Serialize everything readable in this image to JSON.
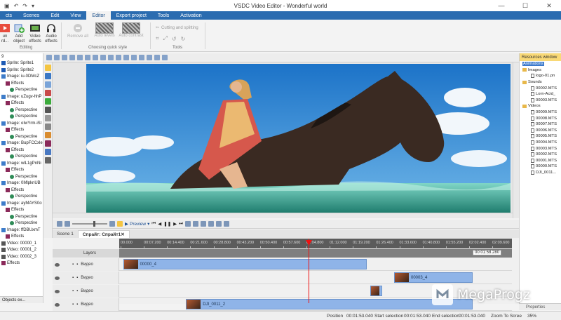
{
  "window": {
    "title": "VSDC Video Editor - Wonderful world",
    "controls": [
      "—",
      "☐",
      "✕"
    ]
  },
  "ribbon_tabs": [
    "cts",
    "Scenes",
    "Edit",
    "View",
    "Editor",
    "Export project",
    "Tools",
    "Activation"
  ],
  "ribbon_active_tab": "Editor",
  "ribbon": {
    "run_label": "un\nrd...",
    "add_object_label": "Add\nobject",
    "video_effects_label": "Video\neffects",
    "audio_effects_label": "Audio\neffects",
    "editing_group": "Editing",
    "remove_all_label": "Remove all",
    "auto_levels_label": "Auto levels",
    "auto_contrast_label": "Auto contrast",
    "quick_style_group": "Choosing quick style",
    "cutting_label": "Cutting and splitting",
    "tools_group": "Tools"
  },
  "object_tree": [
    {
      "label": "9",
      "icon": "none",
      "indent": 0
    },
    {
      "label": "Sprite: Sprite1",
      "icon": "blue",
      "indent": 0
    },
    {
      "label": "Sprite: Sprite2",
      "icon": "blue",
      "indent": 0
    },
    {
      "label": "Image: iu-0DMcZ",
      "icon": "img",
      "indent": 0
    },
    {
      "label": "Effects",
      "icon": "fx",
      "indent": 1
    },
    {
      "label": "Perspective",
      "icon": "persp",
      "indent": 2
    },
    {
      "label": "Image: uZugv-hhP",
      "icon": "img",
      "indent": 0
    },
    {
      "label": "Effects",
      "icon": "fx",
      "indent": 1
    },
    {
      "label": "Perspective",
      "icon": "persp",
      "indent": 2
    },
    {
      "label": "Perspective",
      "icon": "persp",
      "indent": 2
    },
    {
      "label": "Image: oIwYrm-iSI",
      "icon": "img",
      "indent": 0
    },
    {
      "label": "Effects",
      "icon": "fx",
      "indent": 1
    },
    {
      "label": "Perspective",
      "icon": "persp",
      "indent": 2
    },
    {
      "label": "Image: BupFCCxle",
      "icon": "img",
      "indent": 0
    },
    {
      "label": "Effects",
      "icon": "fx",
      "indent": 1
    },
    {
      "label": "Perspective",
      "icon": "persp",
      "indent": 2
    },
    {
      "label": "Image: wlL1gPnNi",
      "icon": "img",
      "indent": 0
    },
    {
      "label": "Effects",
      "icon": "fx",
      "indent": 1
    },
    {
      "label": "Perspective",
      "icon": "persp",
      "indent": 2
    },
    {
      "label": "Image: 0MlpknUB",
      "icon": "img",
      "indent": 0
    },
    {
      "label": "Effects",
      "icon": "fx",
      "indent": 1
    },
    {
      "label": "Perspective",
      "icon": "persp",
      "indent": 2
    },
    {
      "label": "Image: ayMAYS0o",
      "icon": "img",
      "indent": 0
    },
    {
      "label": "Effects",
      "icon": "fx",
      "indent": 1
    },
    {
      "label": "Perspective",
      "icon": "persp",
      "indent": 2
    },
    {
      "label": "Perspective",
      "icon": "persp",
      "indent": 2
    },
    {
      "label": "Image: ffDBUxmT",
      "icon": "img",
      "indent": 0
    },
    {
      "label": "Effects",
      "icon": "fx",
      "indent": 1
    },
    {
      "label": "Video: 00000_1",
      "icon": "vid",
      "indent": 0
    },
    {
      "label": "Video: 00001_2",
      "icon": "vid",
      "indent": 0
    },
    {
      "label": "Video: 00002_3",
      "icon": "vid",
      "indent": 0
    },
    {
      "label": "Effects",
      "icon": "fx",
      "indent": 0
    }
  ],
  "left_tabs": [
    "Objects ex..."
  ],
  "resources": {
    "header": "Resources window",
    "items": [
      {
        "label": "Animations",
        "type": "sel",
        "indent": 0
      },
      {
        "label": "Images",
        "type": "folder",
        "indent": 0
      },
      {
        "label": "logo-01.pn",
        "type": "file",
        "indent": 1
      },
      {
        "label": "Sounds",
        "type": "folder",
        "indent": 0
      },
      {
        "label": "00002.MTS",
        "type": "file",
        "indent": 1
      },
      {
        "label": "Lorn-Acid_",
        "type": "file",
        "indent": 1
      },
      {
        "label": "00003.MTS",
        "type": "file",
        "indent": 1
      },
      {
        "label": "Videos",
        "type": "folder",
        "indent": 0
      },
      {
        "label": "00009.MTS",
        "type": "file",
        "indent": 1
      },
      {
        "label": "00008.MTS",
        "type": "file",
        "indent": 1
      },
      {
        "label": "00007.MTS",
        "type": "file",
        "indent": 1
      },
      {
        "label": "00006.MTS",
        "type": "file",
        "indent": 1
      },
      {
        "label": "00005.MTS",
        "type": "file",
        "indent": 1
      },
      {
        "label": "00004.MTS",
        "type": "file",
        "indent": 1
      },
      {
        "label": "00003.MTS",
        "type": "file",
        "indent": 1
      },
      {
        "label": "00002.MTS",
        "type": "file",
        "indent": 1
      },
      {
        "label": "00001.MTS",
        "type": "file",
        "indent": 1
      },
      {
        "label": "00000.MTS",
        "type": "file",
        "indent": 1
      },
      {
        "label": "DJI_0011...",
        "type": "file",
        "indent": 1
      }
    ],
    "properties_label": "Properties"
  },
  "playback": {
    "preview_label": "Preview"
  },
  "scene_tabs": [
    {
      "label": "Scene 1",
      "active": false
    },
    {
      "label": "Спрайт: Спрайт1",
      "active": true
    }
  ],
  "timeline": {
    "layers_label": "Layers",
    "ruler_ticks": [
      "00.000",
      "00:07.200",
      "00:14.400",
      "00:21.600",
      "00:28.800",
      "00:43.200",
      "00:50.400",
      "00:57.600",
      "01:04.800",
      "01:12.000",
      "01:19.200",
      "01:26.400",
      "01:33.600",
      "01:40.800",
      "01:55.200",
      "02:02.400",
      "02:09.600"
    ],
    "current_time": "00:01:58.280",
    "tracks": [
      {
        "label": "Видео",
        "clips": [
          {
            "name": "00000_4",
            "start": 0.01,
            "end": 0.63
          }
        ]
      },
      {
        "label": "Видео",
        "clips": [
          {
            "name": "00003_4",
            "start": 0.7,
            "end": 0.9
          }
        ]
      },
      {
        "label": "Видео",
        "clips": [
          {
            "name": "",
            "start": 0.64,
            "end": 0.67
          }
        ]
      },
      {
        "label": "Видео",
        "clips": [
          {
            "name": "DJI_0011_2",
            "start": 0.17,
            "end": 0.9
          }
        ]
      }
    ]
  },
  "statusbar": {
    "position_label": "Position",
    "position_value": "00:01:53.040",
    "start_sel_label": "Start selection",
    "start_sel_value": "00:01:53.040",
    "end_sel_label": "End selection",
    "end_sel_value": "00:01:53.040",
    "zoom_label": "Zoom To Scree",
    "zoom_value": "35%"
  },
  "watermark": {
    "brand": "MegaProgz"
  },
  "colors": {
    "ribbon_blue": "#2b6cb0",
    "clip_blue": "#8fb4e8",
    "playhead_red": "#e11111",
    "resources_header": "#f9d976"
  }
}
